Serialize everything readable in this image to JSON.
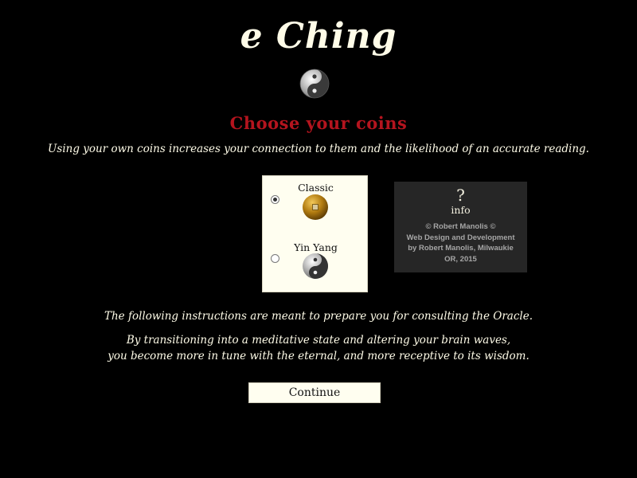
{
  "app": {
    "title": "e Ching"
  },
  "header": {
    "heading": "Choose your coins",
    "intro": "Using your own coins increases your connection to them and the likelihood of an accurate reading.",
    "logo_icon": "yin-yang-icon"
  },
  "coins": {
    "options": [
      {
        "label": "Classic",
        "checked": true,
        "icon": "classic-coin-icon"
      },
      {
        "label": "Yin Yang",
        "checked": false,
        "icon": "yin-yang-coin-icon"
      }
    ]
  },
  "info": {
    "icon_glyph": "?",
    "icon": "question-mark-icon",
    "label": "info",
    "credit_line1": "© Robert Manolis ©",
    "credit_line2": "Web Design and Development",
    "credit_line3": "by Robert Manolis, Milwaukie",
    "credit_line4": "OR, 2015"
  },
  "instructions": {
    "line1": "The following instructions are meant to prepare you for consulting the Oracle.",
    "line2": "By transitioning into a meditative state and altering your brain waves,",
    "line3": "you become more in tune with the eternal, and more receptive to its wisdom."
  },
  "actions": {
    "continue_label": "Continue"
  },
  "colors": {
    "background": "#000000",
    "text": "#fffce8",
    "heading": "#b4141e",
    "panel": "#fffef0",
    "info_box": "#262626"
  }
}
